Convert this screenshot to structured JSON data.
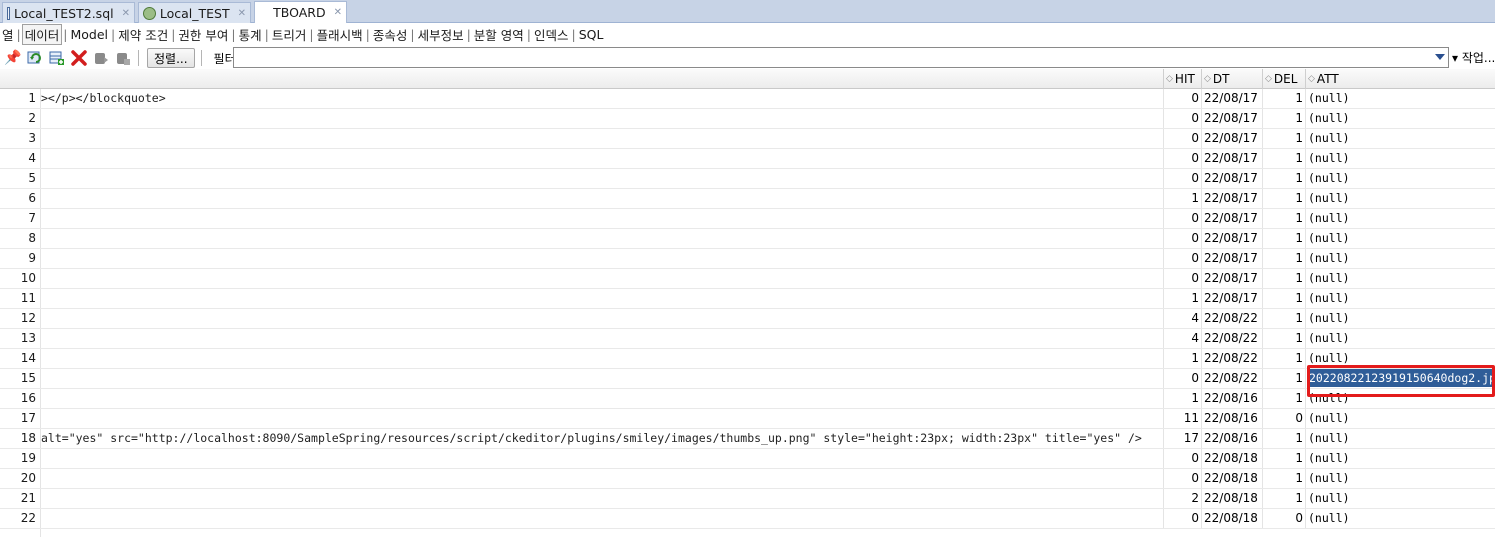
{
  "tabs": [
    {
      "label": "Local_TEST2.sql",
      "icon": "sql-file-icon",
      "active": false
    },
    {
      "label": "Local_TEST",
      "icon": "sql-worksheet-icon",
      "active": false
    },
    {
      "label": "TBOARD",
      "icon": "table-icon",
      "active": true
    }
  ],
  "subtabs": [
    "열",
    "데이터",
    "Model",
    "제약 조건",
    "권한 부여",
    "통계",
    "트리거",
    "플래시백",
    "종속성",
    "세부정보",
    "분할 영역",
    "인덱스",
    "SQL"
  ],
  "selected_subtab": "데이터",
  "toolbar": {
    "sort_label": "정렬...",
    "filter_label": "필터:",
    "filter_value": "",
    "actions_label": "▾ 작업..."
  },
  "columns": [
    "HIT",
    "DT",
    "DEL",
    "ATT"
  ],
  "rows": [
    {
      "n": "1",
      "content": "></p></blockquote>",
      "hit": "0",
      "dt": "22/08/17",
      "del": "1",
      "att": "(null)"
    },
    {
      "n": "2",
      "content": "",
      "hit": "0",
      "dt": "22/08/17",
      "del": "1",
      "att": "(null)"
    },
    {
      "n": "3",
      "content": "",
      "hit": "0",
      "dt": "22/08/17",
      "del": "1",
      "att": "(null)"
    },
    {
      "n": "4",
      "content": "",
      "hit": "0",
      "dt": "22/08/17",
      "del": "1",
      "att": "(null)"
    },
    {
      "n": "5",
      "content": "",
      "hit": "0",
      "dt": "22/08/17",
      "del": "1",
      "att": "(null)"
    },
    {
      "n": "6",
      "content": "",
      "hit": "1",
      "dt": "22/08/17",
      "del": "1",
      "att": "(null)"
    },
    {
      "n": "7",
      "content": "",
      "hit": "0",
      "dt": "22/08/17",
      "del": "1",
      "att": "(null)"
    },
    {
      "n": "8",
      "content": "",
      "hit": "0",
      "dt": "22/08/17",
      "del": "1",
      "att": "(null)"
    },
    {
      "n": "9",
      "content": "",
      "hit": "0",
      "dt": "22/08/17",
      "del": "1",
      "att": "(null)"
    },
    {
      "n": "10",
      "content": "",
      "hit": "0",
      "dt": "22/08/17",
      "del": "1",
      "att": "(null)"
    },
    {
      "n": "11",
      "content": "",
      "hit": "1",
      "dt": "22/08/17",
      "del": "1",
      "att": "(null)"
    },
    {
      "n": "12",
      "content": "",
      "hit": "4",
      "dt": "22/08/22",
      "del": "1",
      "att": "(null)"
    },
    {
      "n": "13",
      "content": "",
      "hit": "4",
      "dt": "22/08/22",
      "del": "1",
      "att": "(null)"
    },
    {
      "n": "14",
      "content": "",
      "hit": "1",
      "dt": "22/08/22",
      "del": "1",
      "att": "(null)"
    },
    {
      "n": "15",
      "content": "",
      "hit": "0",
      "dt": "22/08/22",
      "del": "1",
      "att": ""
    },
    {
      "n": "16",
      "content": "",
      "hit": "1",
      "dt": "22/08/16",
      "del": "1",
      "att": "(null)"
    },
    {
      "n": "17",
      "content": "",
      "hit": "11",
      "dt": "22/08/16",
      "del": "0",
      "att": "(null)"
    },
    {
      "n": "18",
      "content": " alt=\"yes\" src=\"http://localhost:8090/SampleSpring/resources/script/ckeditor/plugins/smiley/images/thumbs_up.png\" style=\"height:23px; width:23px\" title=\"yes\" />",
      "hit": "17",
      "dt": "22/08/16",
      "del": "1",
      "att": "(null)"
    },
    {
      "n": "19",
      "content": "",
      "hit": "0",
      "dt": "22/08/18",
      "del": "1",
      "att": "(null)"
    },
    {
      "n": "20",
      "content": "",
      "hit": "0",
      "dt": "22/08/18",
      "del": "1",
      "att": "(null)"
    },
    {
      "n": "21",
      "content": "",
      "hit": "2",
      "dt": "22/08/18",
      "del": "1",
      "att": "(null)"
    },
    {
      "n": "22",
      "content": "",
      "hit": "0",
      "dt": "22/08/18",
      "del": "0",
      "att": "(null)"
    }
  ],
  "selected_cell_value": "20220822123919150640dog2.jp",
  "colors": {
    "selection": "#2f5d98",
    "highlight_border": "#e31b1b",
    "tabbar": "#c7d3e6"
  }
}
